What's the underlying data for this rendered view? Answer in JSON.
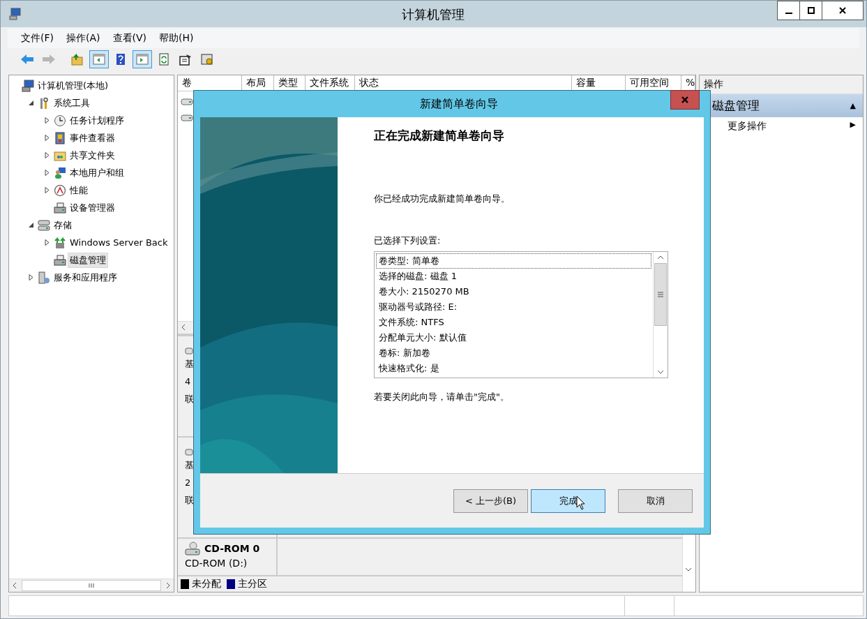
{
  "window": {
    "title": "计算机管理"
  },
  "menu": [
    "文件(F)",
    "操作(A)",
    "查看(V)",
    "帮助(H)"
  ],
  "toolbar": [
    {
      "kind": "back",
      "disabled": false,
      "on": false
    },
    {
      "kind": "forward",
      "disabled": true,
      "on": false
    },
    {
      "kind": "up",
      "disabled": false,
      "on": false
    },
    {
      "kind": "tree-pane",
      "disabled": false,
      "on": true
    },
    {
      "kind": "help",
      "disabled": false,
      "on": false
    },
    {
      "kind": "action-pane",
      "disabled": false,
      "on": true
    },
    {
      "kind": "export",
      "disabled": false,
      "on": false
    },
    {
      "kind": "properties",
      "disabled": false,
      "on": false
    },
    {
      "kind": "settings",
      "disabled": false,
      "on": false
    }
  ],
  "tree": [
    {
      "label": "计算机管理(本地)",
      "kind": "computer",
      "selected": false,
      "children": [
        {
          "label": "系统工具",
          "kind": "tools",
          "expanded": true,
          "selected": false,
          "children": [
            {
              "label": "任务计划程序",
              "kind": "clock",
              "expanded": false,
              "selected": false
            },
            {
              "label": "事件查看器",
              "kind": "log",
              "expanded": false,
              "selected": false
            },
            {
              "label": "共享文件夹",
              "kind": "folder",
              "expanded": false,
              "selected": false
            },
            {
              "label": "本地用户和组",
              "kind": "users",
              "expanded": false,
              "selected": false
            },
            {
              "label": "性能",
              "kind": "gauge",
              "expanded": false,
              "selected": false
            },
            {
              "label": "设备管理器",
              "kind": "device",
              "selected": false
            }
          ]
        },
        {
          "label": "存储",
          "kind": "storage",
          "expanded": true,
          "selected": false,
          "children": [
            {
              "label": "Windows Server Back",
              "kind": "backup",
              "expanded": false,
              "selected": false
            },
            {
              "label": "磁盘管理",
              "kind": "disk",
              "selected": true
            }
          ]
        },
        {
          "label": "服务和应用程序",
          "kind": "services",
          "expanded": false,
          "selected": false
        }
      ]
    }
  ],
  "table": {
    "columns": [
      "卷",
      "布局",
      "类型",
      "文件系统",
      "状态",
      "容量",
      "可用空间",
      "%"
    ]
  },
  "disks": [
    {
      "lines": [
        "基",
        "4",
        "联"
      ]
    },
    {
      "lines": [
        "基",
        "2",
        "联"
      ]
    },
    {
      "name": "CD-ROM 0",
      "detail": "CD-ROM (D:)"
    }
  ],
  "legend": [
    {
      "label": "未分配",
      "color": "#000000"
    },
    {
      "label": "主分区",
      "color": "#000080"
    }
  ],
  "actions": {
    "header": "操作",
    "section": "磁盘管理",
    "section_arrow": "▲",
    "items": [
      {
        "label": "更多操作",
        "arrow": "▶"
      }
    ]
  },
  "dialog": {
    "title": "新建简单卷向导",
    "heading": "正在完成新建简单卷向导",
    "intro": "你已经成功完成新建简单卷向导。",
    "settings_label": "已选择下列设置:",
    "settings": [
      {
        "text": "卷类型: 简单卷",
        "selected": true
      },
      {
        "text": "选择的磁盘: 磁盘 1",
        "selected": false
      },
      {
        "text": "卷大小: 2150270 MB",
        "selected": false
      },
      {
        "text": "驱动器号或路径: E:",
        "selected": false
      },
      {
        "text": "文件系统: NTFS",
        "selected": false
      },
      {
        "text": "分配单元大小: 默认值",
        "selected": false
      },
      {
        "text": "卷标: 新加卷",
        "selected": false
      },
      {
        "text": "快速格式化: 是",
        "selected": false
      }
    ],
    "closing": "若要关闭此向导，请单击\"完成\"。",
    "buttons": [
      {
        "label": "< 上一步(B)",
        "default": false
      },
      {
        "label": "完成",
        "default": true
      },
      {
        "label": "取消",
        "default": false
      }
    ]
  }
}
